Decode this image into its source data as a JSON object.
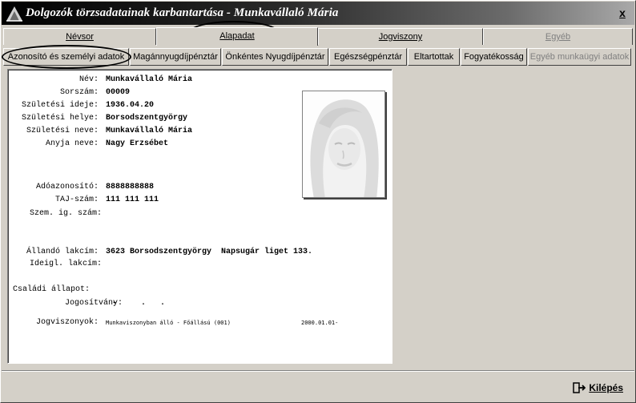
{
  "window": {
    "title": "Dolgozók törzsadatainak karbantartása - Munkavállaló Mária",
    "close_label": "x"
  },
  "main_tabs": [
    {
      "label": "Névsor"
    },
    {
      "label": "Alapadat"
    },
    {
      "label": "Jogviszony"
    },
    {
      "label": "Egyéb"
    }
  ],
  "sub_tabs": [
    {
      "label": "Azonosító és személyi adatok"
    },
    {
      "label": "Magánnyugdíjpénztár"
    },
    {
      "label": "Önkéntes Nyugdíjpénztár"
    },
    {
      "label": "Egészségpénztár"
    },
    {
      "label": "Eltartottak"
    },
    {
      "label": "Fogyatékosság"
    },
    {
      "label": "Egyéb munkaügyi adatok"
    }
  ],
  "fields": {
    "nev": {
      "label": "Név:",
      "value": "Munkavállaló Mária"
    },
    "sorszam": {
      "label": "Sorszám:",
      "value": "00009"
    },
    "szuletesi_ideje": {
      "label": "Születési ideje:",
      "value": "1936.04.20"
    },
    "szuletesi_helye": {
      "label": "Születési helye:",
      "value": "Borsodszentgyörgy"
    },
    "szuletesi_neve": {
      "label": "Születési neve:",
      "value": "Munkavállaló Mária"
    },
    "anyja_neve": {
      "label": "Anyja neve:",
      "value": "Nagy Erzsébet"
    },
    "adoazonosito": {
      "label": "Adóazonosító:",
      "value": "8888888888"
    },
    "taj": {
      "label": "TAJ-szám:",
      "value": "111 111 111"
    },
    "szem_ig": {
      "label": "Szem. ig. szám:",
      "value": ""
    },
    "allando_lakcim": {
      "label": "Állandó lakcím:",
      "value": "3623 Borsodszentgyörgy  Napsugár liget 133."
    },
    "ideigl_lakcim": {
      "label": "Ideigl. lakcím:",
      "value": ""
    },
    "csaladi_allapot": {
      "label": "Családi állapot:",
      "value": ""
    },
    "jogositvany": {
      "label": "Jogosítvány:",
      "value": "-     .   ."
    },
    "jogviszonyok": {
      "label": "Jogviszonyok:",
      "value": "Munkaviszonyban álló - Főállású (001)",
      "date": "2000.01.01-"
    }
  },
  "footer": {
    "exit_label": "Kilépés",
    "exit_icon": "exit-door-icon"
  },
  "colors": {
    "window_bg": "#d4d0c8",
    "title_dark": "#000000",
    "panel_bg": "#ffffff"
  }
}
